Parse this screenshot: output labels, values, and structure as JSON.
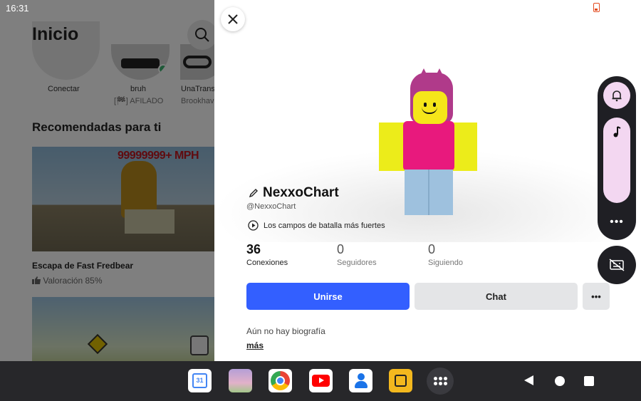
{
  "status_bar": {
    "time": "16:31"
  },
  "background_app": {
    "title": "Inicio",
    "friends": [
      {
        "name": "Conectar",
        "status": ""
      },
      {
        "name": "bruh",
        "status": "[🏁] AFILADO"
      },
      {
        "name": "UnaTrans",
        "status": "Brookhav"
      }
    ],
    "section_title": "Recomendadas para ti",
    "game": {
      "thumbnail_text": "99999999+ MPH",
      "title": "Escapa de Fast Fredbear",
      "rating": "Valoración 85%"
    }
  },
  "profile": {
    "display_name": "NexxoChart",
    "username": "@NexxoChart",
    "current_game": "Los campos de batalla más fuertes",
    "stats": [
      {
        "value": "36",
        "label": "Conexiones"
      },
      {
        "value": "0",
        "label": "Seguidores"
      },
      {
        "value": "0",
        "label": "Siguiendo"
      }
    ],
    "buttons": {
      "join": "Unirse",
      "chat": "Chat",
      "more": "•••"
    },
    "bio": "Aún no hay biografía",
    "more_link": "más"
  },
  "side_dock": {
    "more": "•••"
  },
  "taskbar": {
    "calendar_day": "31",
    "apps": [
      "calendar-icon",
      "photos-icon",
      "chrome-icon",
      "youtube-icon",
      "contacts-icon",
      "game-icon",
      "app-drawer-icon"
    ]
  },
  "colors": {
    "join_button": "#335fff",
    "dock_accent": "#f3d7f1",
    "taskbar": "#27272a"
  }
}
